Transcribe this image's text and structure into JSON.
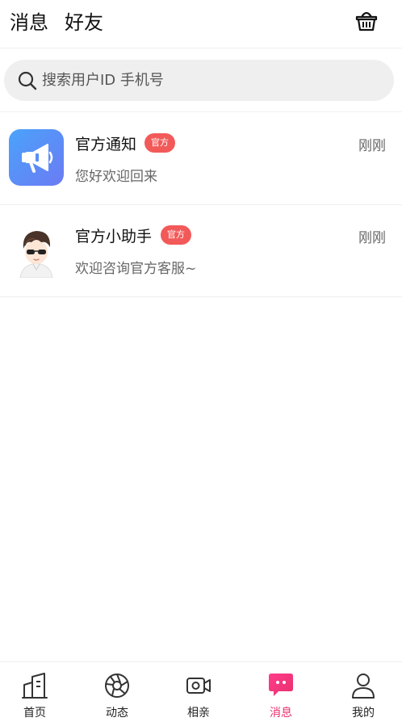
{
  "header": {
    "tabs": [
      {
        "label": "消息",
        "active": true
      },
      {
        "label": "好友",
        "active": false
      }
    ],
    "cart_icon": "basket-icon"
  },
  "search": {
    "placeholder": "搜索用户ID 手机号",
    "value": "",
    "icon": "search-icon"
  },
  "conversations": [
    {
      "name": "官方通知",
      "badge": "官方",
      "time": "刚刚",
      "preview": "您好欢迎回来",
      "avatar": "megaphone-icon"
    },
    {
      "name": "官方小助手",
      "badge": "官方",
      "time": "刚刚",
      "preview": "欢迎咨询官方客服~",
      "avatar": "assistant-avatar"
    }
  ],
  "tabbar": {
    "items": [
      {
        "label": "首页",
        "icon": "home-building-icon",
        "active": false
      },
      {
        "label": "动态",
        "icon": "aperture-icon",
        "active": false
      },
      {
        "label": "相亲",
        "icon": "video-camera-icon",
        "active": false
      },
      {
        "label": "消息",
        "icon": "chat-bubble-icon",
        "active": true
      },
      {
        "label": "我的",
        "icon": "person-icon",
        "active": false
      }
    ]
  },
  "colors": {
    "accent": "#e8306e",
    "badge": "#f25a5a",
    "notice_gradient_start": "#4aa3fb",
    "notice_gradient_end": "#6b7bf3"
  }
}
